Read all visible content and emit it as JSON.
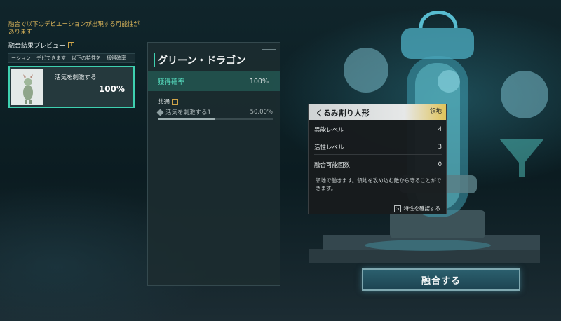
{
  "notice": "融合で以下のデビエーションが出現する可能性があります",
  "preview": {
    "title": "融合結果プレビュー",
    "info_icon": "I",
    "headers": [
      "ーション",
      "デビできます",
      "以下の特性を",
      "獲得確率"
    ]
  },
  "result_card": {
    "name": "活気を刺激する",
    "percent": "100%"
  },
  "detail": {
    "name": "グリーン・ドラゴン",
    "rate_label": "獲得確率",
    "rate_value": "100%",
    "common_label": "共通",
    "common_icon": "I",
    "trait_name": "活気を刺激する1",
    "trait_value": "50.00%",
    "trait_progress": 0.5
  },
  "tooltip": {
    "title": "くるみ割り人形",
    "tag": "領地",
    "stats": [
      {
        "label": "異能レベル",
        "value": "4"
      },
      {
        "label": "活性レベル",
        "value": "3"
      },
      {
        "label": "融合可能回数",
        "value": "0"
      }
    ],
    "description": "領地で働きます。領地を攻め込む敵から守ることができます。",
    "key": "G",
    "footer": "特性を確認する"
  },
  "fuse_button": "融合する",
  "colors": {
    "accent": "#3ed0b0",
    "notice": "#d9b45a",
    "tag_gold": "#e0c45a"
  }
}
